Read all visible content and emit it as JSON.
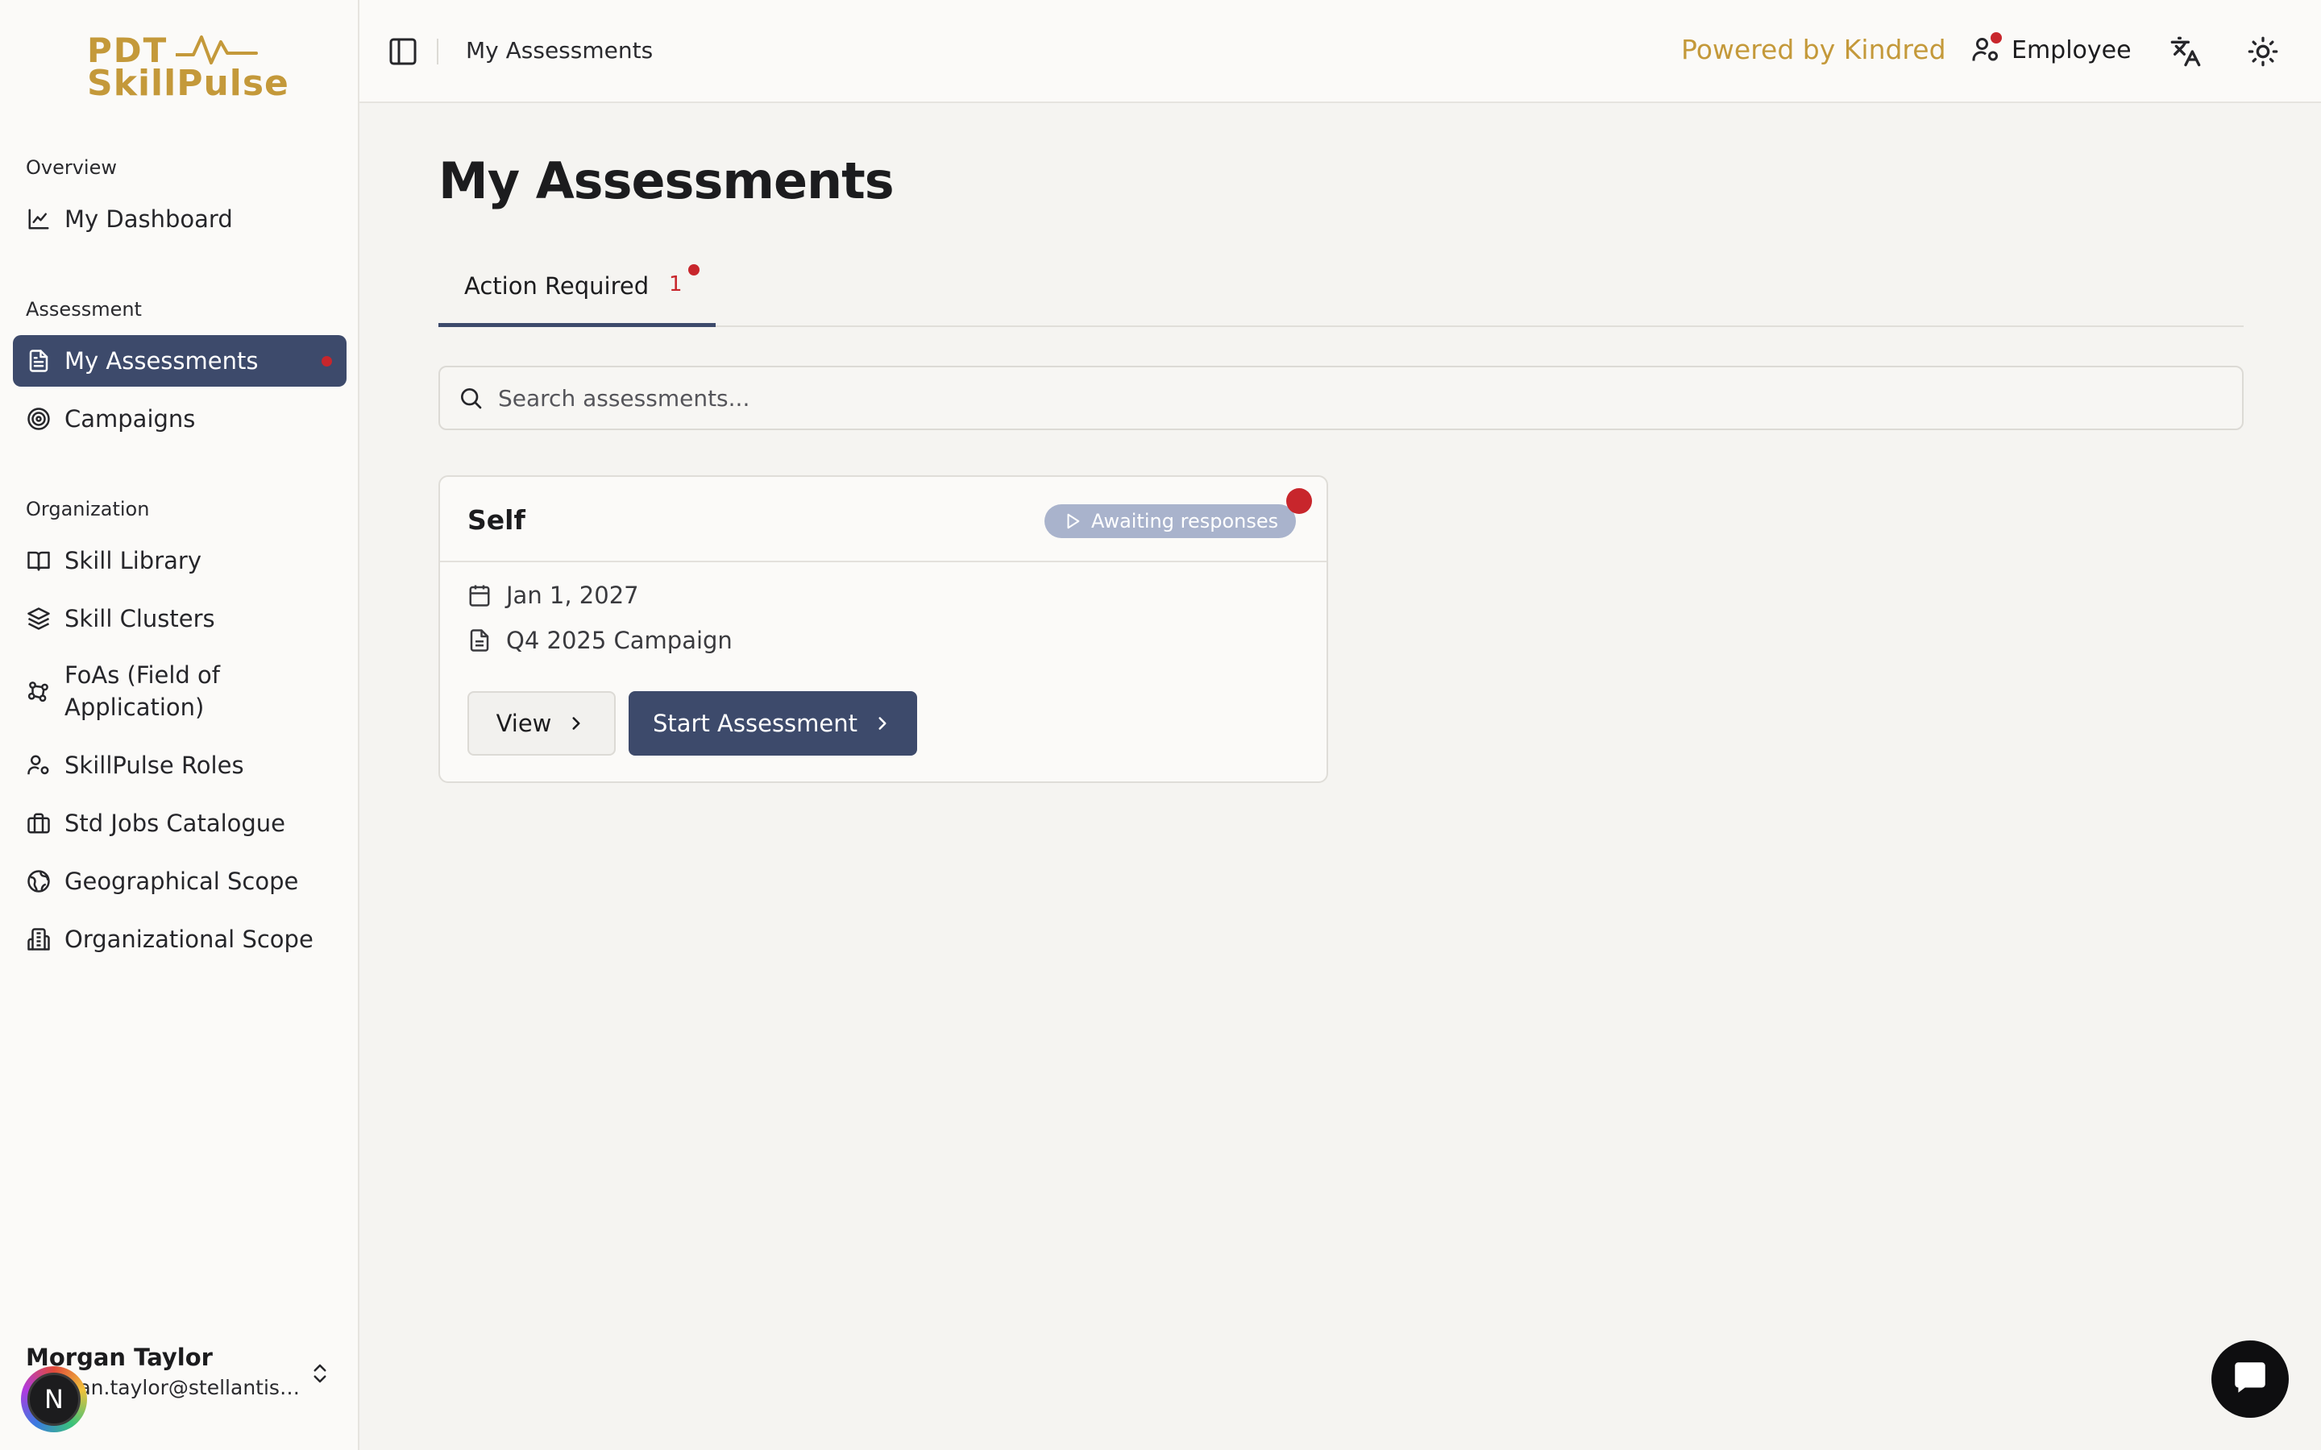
{
  "logo": {
    "line1": "PDT",
    "line2": "SkillPulse"
  },
  "sidebar": {
    "sections": {
      "overview": "Overview",
      "assessment": "Assessment",
      "organization": "Organization"
    },
    "items": [
      {
        "label": "My Dashboard",
        "icon": "chart-line-icon"
      },
      {
        "label": "My Assessments",
        "icon": "document-icon",
        "active": true
      },
      {
        "label": "Campaigns",
        "icon": "target-icon"
      },
      {
        "label": "Skill Library",
        "icon": "book-open-icon"
      },
      {
        "label": "Skill Clusters",
        "icon": "layers-icon"
      },
      {
        "label": "FoAs (Field of Application)",
        "icon": "network-icon"
      },
      {
        "label": "SkillPulse Roles",
        "icon": "user-cog-icon"
      },
      {
        "label": "Std Jobs Catalogue",
        "icon": "briefcase-icon"
      },
      {
        "label": "Geographical Scope",
        "icon": "globe-icon"
      },
      {
        "label": "Organizational Scope",
        "icon": "building-icon"
      }
    ],
    "user": {
      "name": "Morgan Taylor",
      "email": "morgan.taylor@stellantis.t...",
      "avatar_letter": "N"
    }
  },
  "topbar": {
    "breadcrumb": "My Assessments",
    "powered_by": "Powered by Kindred",
    "role": "Employee"
  },
  "main": {
    "title": "My Assessments",
    "tabs": [
      {
        "label": "Action Required",
        "count": "1"
      }
    ],
    "search": {
      "placeholder": "Search assessments...",
      "value": ""
    },
    "cards": [
      {
        "title": "Self",
        "status": "Awaiting responses",
        "date": "Jan 1, 2027",
        "campaign": "Q4 2025 Campaign",
        "view_label": "View",
        "start_label": "Start Assessment"
      }
    ]
  },
  "colors": {
    "accent": "#3d4a6b",
    "brand_gold": "#c4993a",
    "alert_red": "#c8262c",
    "badge_bg": "#a9b3cc"
  }
}
